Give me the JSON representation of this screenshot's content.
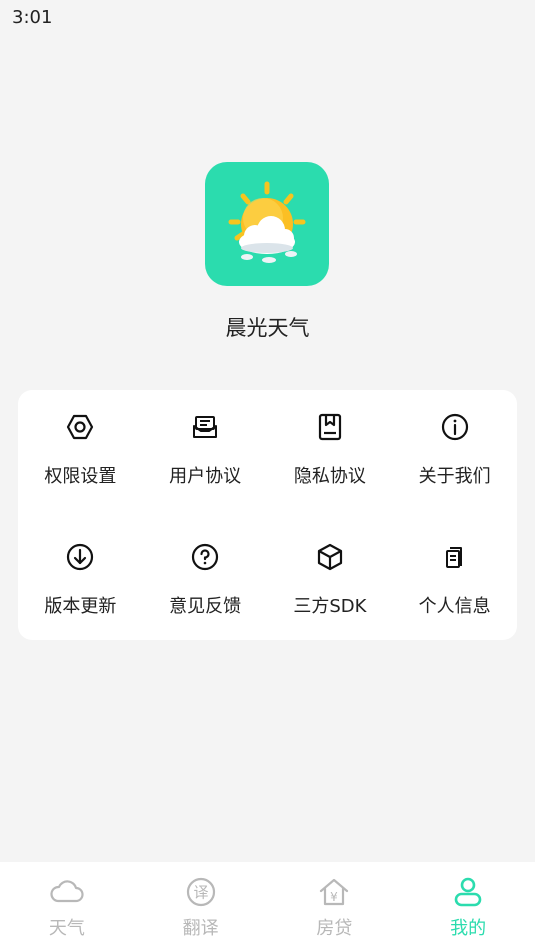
{
  "status_bar": {
    "time": "3:01"
  },
  "app": {
    "name": "晨光天气",
    "icon": "sun-cloud-app-icon"
  },
  "menu": {
    "items": [
      {
        "label": "权限设置",
        "icon": "hexagon-settings-icon"
      },
      {
        "label": "用户协议",
        "icon": "envelope-document-icon"
      },
      {
        "label": "隐私协议",
        "icon": "book-icon"
      },
      {
        "label": "关于我们",
        "icon": "info-icon"
      },
      {
        "label": "版本更新",
        "icon": "download-arrow-icon"
      },
      {
        "label": "意见反馈",
        "icon": "question-icon"
      },
      {
        "label": "三方SDK",
        "icon": "cube-icon"
      },
      {
        "label": "个人信息",
        "icon": "documents-icon"
      }
    ]
  },
  "tabbar": {
    "accent": "#2bdcae",
    "inactive": "#b8b8b8",
    "tabs": [
      {
        "label": "天气",
        "icon": "cloud-icon",
        "active": false
      },
      {
        "label": "翻译",
        "icon": "translate-icon",
        "active": false
      },
      {
        "label": "房贷",
        "icon": "house-yuan-icon",
        "active": false
      },
      {
        "label": "我的",
        "icon": "user-icon",
        "active": true
      }
    ]
  }
}
